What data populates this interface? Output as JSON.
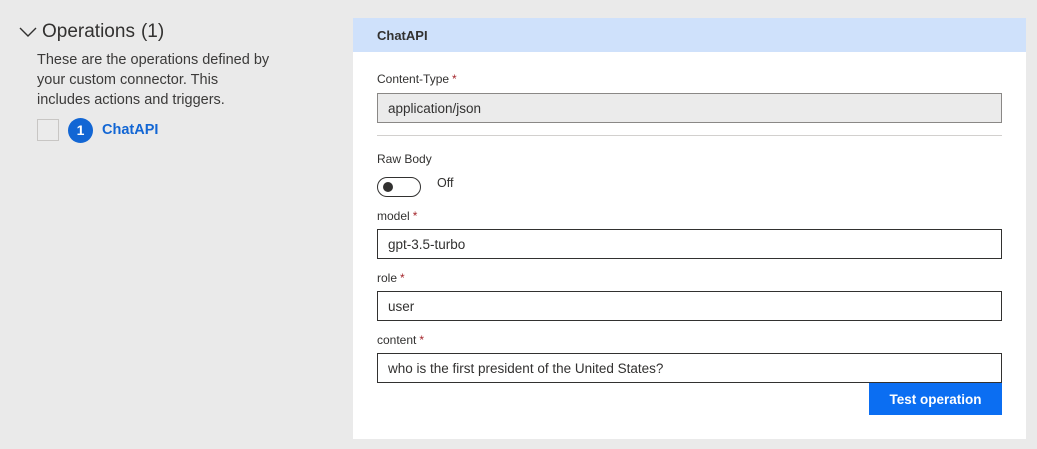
{
  "operations": {
    "title": "Operations",
    "count": "(1)",
    "description": "These are the operations defined by your custom connector. This includes actions and triggers.",
    "items": [
      {
        "number": "1",
        "name": "ChatAPI"
      }
    ]
  },
  "form": {
    "header": "ChatAPI",
    "content_type": {
      "label": "Content-Type",
      "required_mark": "*",
      "value": "application/json"
    },
    "raw_body": {
      "label": "Raw Body",
      "state": "Off"
    },
    "model": {
      "label": "model",
      "required_mark": "*",
      "value": "gpt-3.5-turbo"
    },
    "role": {
      "label": "role",
      "required_mark": "*",
      "value": "user"
    },
    "content": {
      "label": "content",
      "required_mark": "*",
      "value": "who is the first president of the United States?"
    },
    "test_button": "Test operation"
  },
  "colors": {
    "accent": "#0b6ef2",
    "header_bg": "#cfe1fb",
    "page_bg": "#eaeaea",
    "required": "#a4262c"
  }
}
